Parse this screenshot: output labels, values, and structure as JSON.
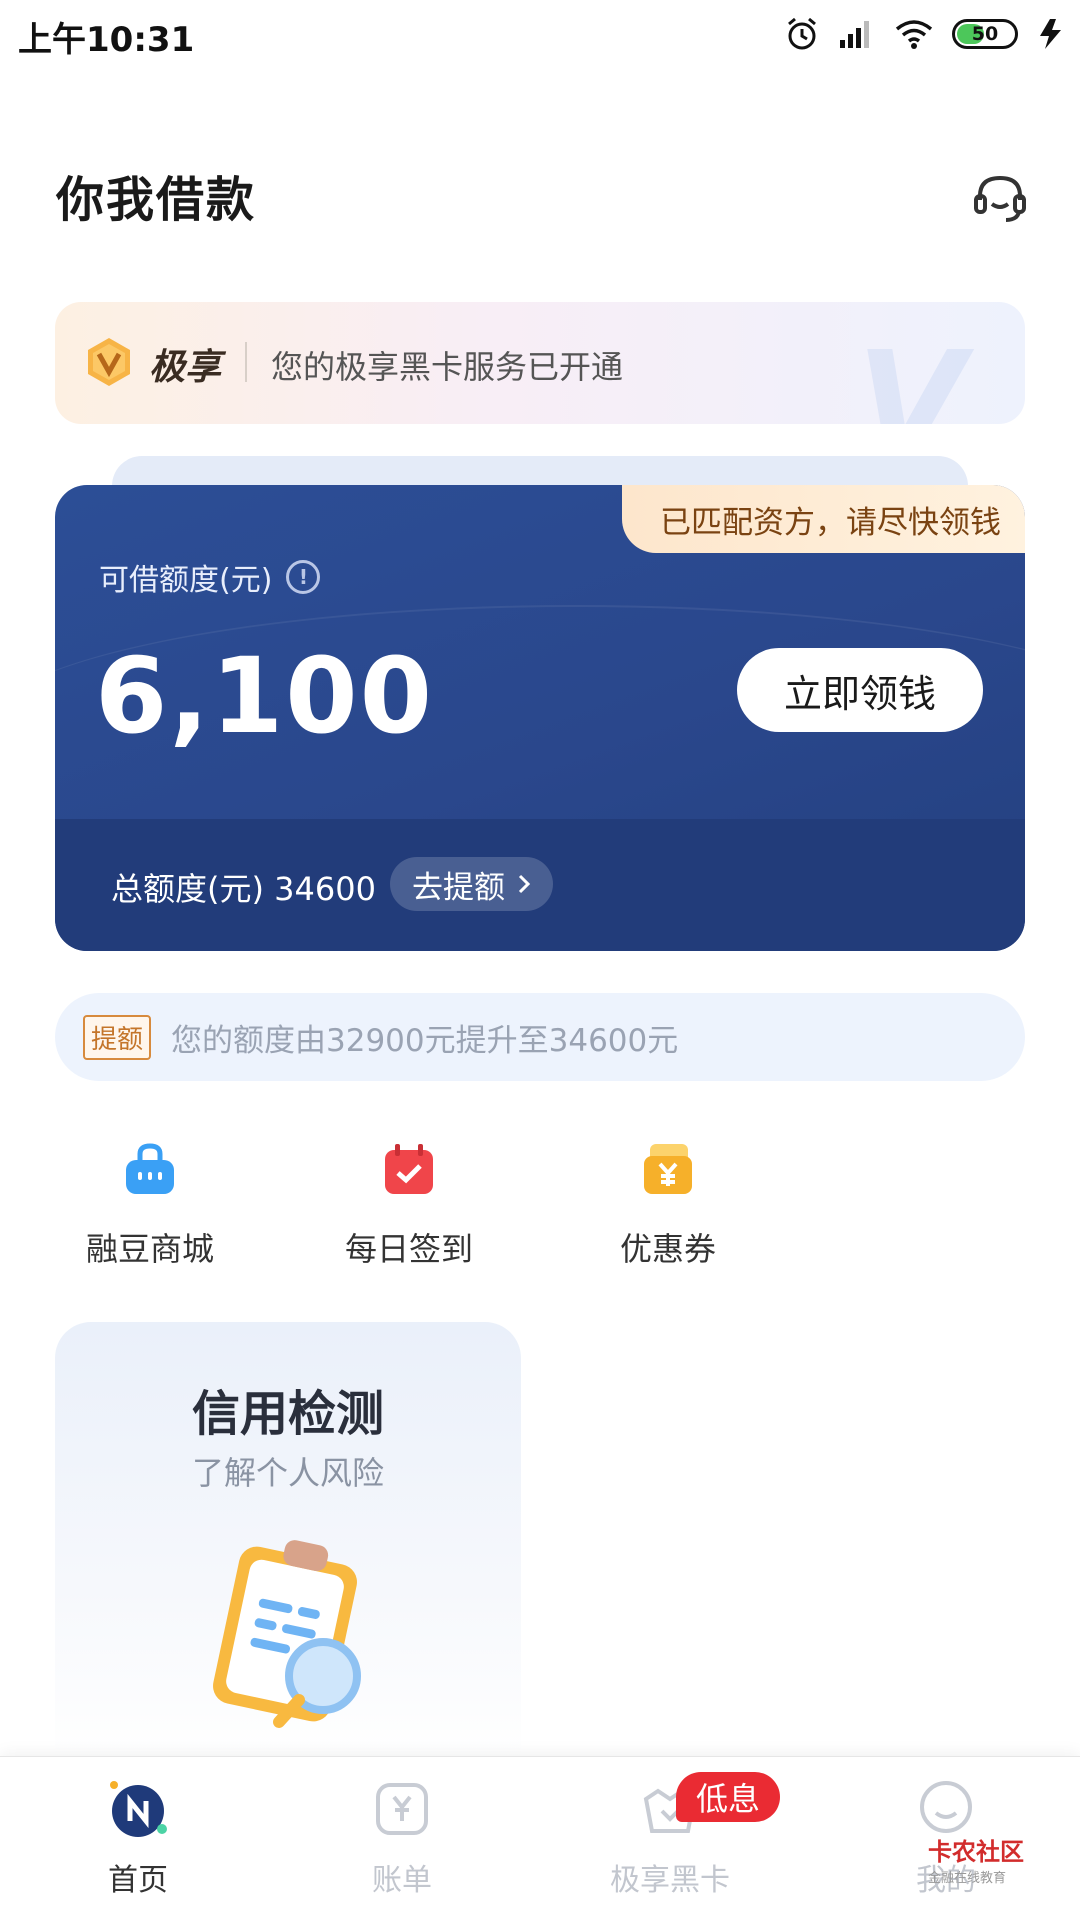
{
  "status_bar": {
    "time": "上午10:31",
    "battery": "50"
  },
  "header": {
    "title": "你我借款"
  },
  "vip_banner": {
    "brand": "极享",
    "message": "您的极享黑卡服务已开通"
  },
  "loan_card": {
    "match_tag": "已匹配资方，请尽快领钱",
    "available_label": "可借额度(元)",
    "available_amount": "6,100",
    "claim_button": "立即领钱",
    "total_label": "总额度(元) 34600",
    "raise_button": "去提额"
  },
  "notice": {
    "tag": "提额",
    "text": "您的额度由32900元提升至34600元"
  },
  "quick_actions": [
    {
      "label": "融豆商城",
      "icon": "shopping-bag-icon",
      "color": "#3aa0f5"
    },
    {
      "label": "每日签到",
      "icon": "calendar-check-icon",
      "color": "#f0454a"
    },
    {
      "label": "优惠券",
      "icon": "coupon-icon",
      "color": "#f6b02a"
    }
  ],
  "credit_card": {
    "title": "信用检测",
    "subtitle": "了解个人风险"
  },
  "bottom_nav": [
    {
      "label": "首页",
      "active": true
    },
    {
      "label": "账单",
      "active": false
    },
    {
      "label": "极享黑卡",
      "active": false
    },
    {
      "label": "我的",
      "active": false
    }
  ],
  "nav_badge": "低息",
  "watermark": {
    "name": "卡农社区",
    "tagline": "金融在线教育"
  },
  "colors": {
    "card_blue": "#2a478c",
    "accent_orange": "#c4752a",
    "badge_red": "#ea2b33"
  }
}
